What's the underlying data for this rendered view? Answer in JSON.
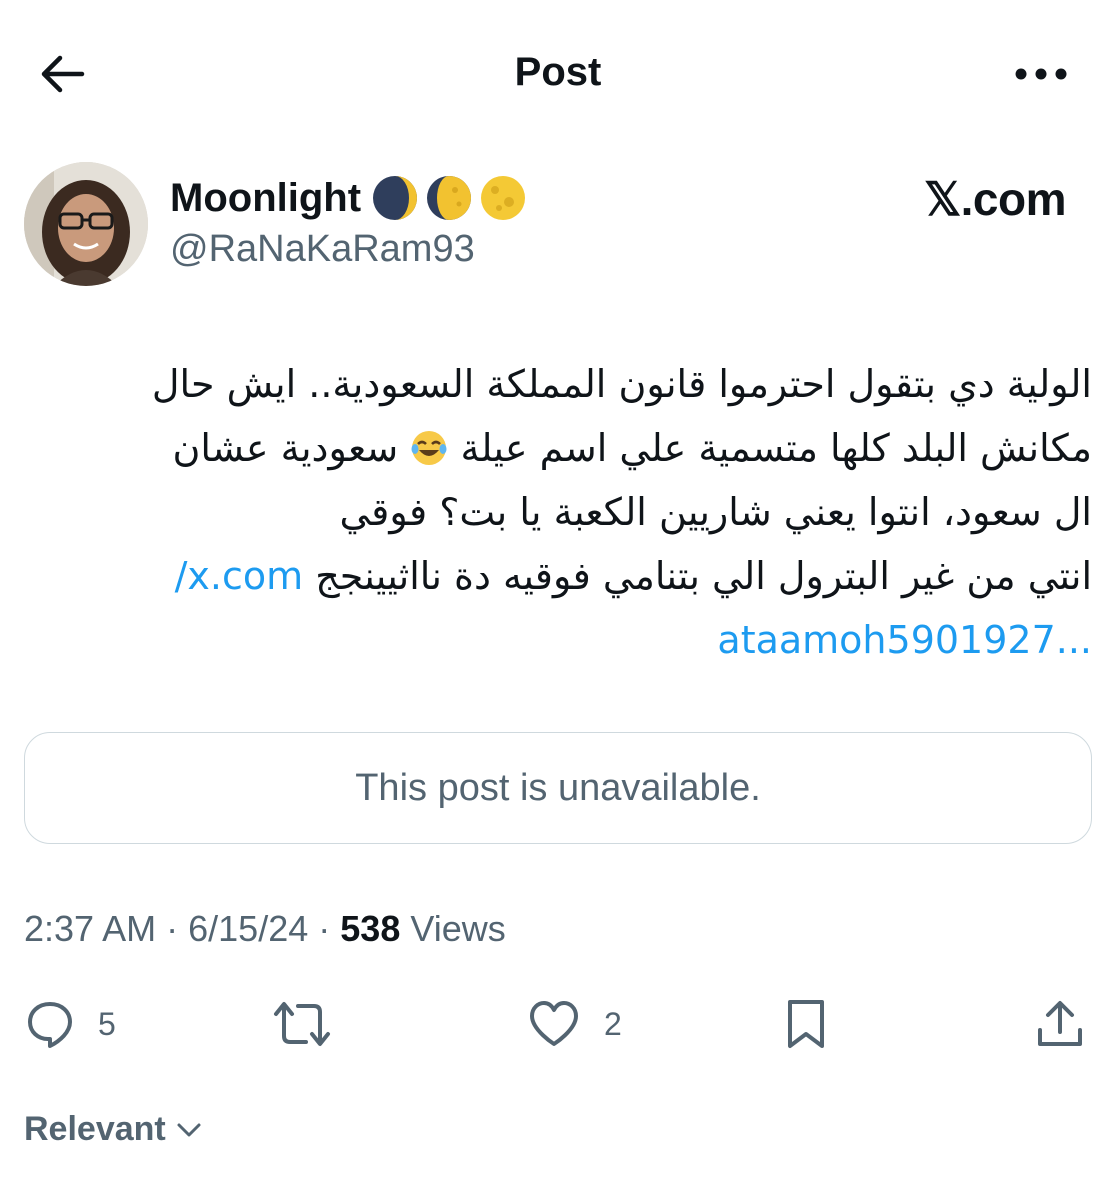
{
  "header": {
    "title": "Post",
    "back_icon": "arrow-left-icon",
    "more_icon": "more-horizontal-icon"
  },
  "author": {
    "display_name": "Moonlight",
    "handle": "@RaNaKaRam93",
    "name_emojis": [
      "waning-crescent-moon",
      "waning-gibbous-moon",
      "full-moon"
    ]
  },
  "watermark": "𝕏.com",
  "tweet": {
    "line1": "الولية دي بتقول احترموا قانون المملكة السعودية.. ايش حال",
    "line2_before": "مكانش البلد كلها متسمية علي اسم عيلة",
    "line2_after": "سعودية عشان",
    "line3": "ال سعود، انتوا يعني شاريين الكعبة يا بت؟ فوقي",
    "line4_text": "انتي من غير البترول الي بتنامي فوقيه دة نااثيينجج",
    "link_part1": "x.com/",
    "link_part2": "ataamoh5901927...",
    "emoji": "face-with-tears-of-joy"
  },
  "quote": {
    "text": "This post is unavailable."
  },
  "meta": {
    "time": "2:37 AM",
    "separator": "·",
    "date": "6/15/24",
    "views_count": "538",
    "views_label": "Views"
  },
  "actions": {
    "reply_count": "5",
    "like_count": "2"
  },
  "replies_sort": {
    "label": "Relevant"
  },
  "colors": {
    "link": "#1d9bf0",
    "secondary_text": "#536471",
    "primary_text": "#0f1419",
    "border": "#cfd9de"
  }
}
